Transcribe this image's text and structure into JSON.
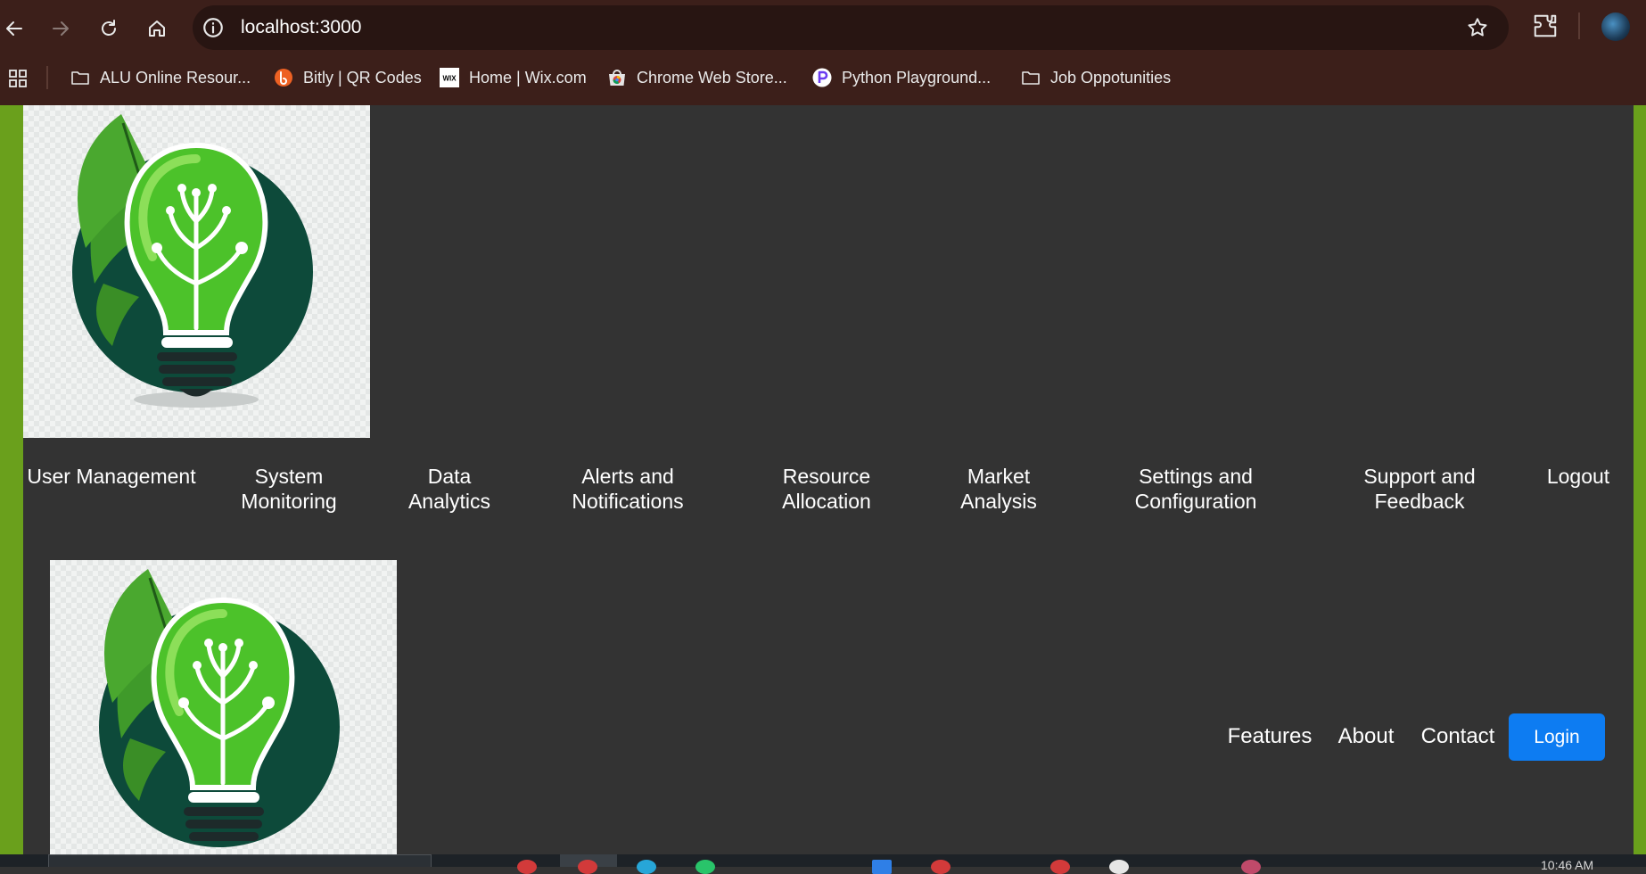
{
  "browser": {
    "url": "localhost:3000",
    "bookmarks": [
      {
        "label": "ALU Online Resour...",
        "icon": "folder-icon"
      },
      {
        "label": "Bitly | QR Codes",
        "icon": "bitly-icon"
      },
      {
        "label": "Home | Wix.com",
        "icon": "wix-icon"
      },
      {
        "label": "Chrome Web Store...",
        "icon": "chrome-web-store-icon"
      },
      {
        "label": "Python Playground...",
        "icon": "python-playground-icon"
      },
      {
        "label": "Job Oppotunities",
        "icon": "folder-icon"
      }
    ]
  },
  "page": {
    "logo_alt": "Lightbulb with tree logo",
    "nav_items": [
      "User Management",
      "System Monitoring",
      "Data Analytics",
      "Alerts and Notifications",
      "Resource Allocation",
      "Market Analysis",
      "Settings and Configuration",
      "Support and Feedback",
      "Logout"
    ],
    "footer_nav": {
      "features": "Features",
      "about": "About",
      "contact": "Contact",
      "login": "Login"
    },
    "colors": {
      "background": "#333333",
      "side_edge": "#6aa01c",
      "login_button": "#0d7cf2",
      "browser_frame": "#3c1f1a"
    }
  },
  "taskbar": {
    "time": "10:46 AM"
  }
}
